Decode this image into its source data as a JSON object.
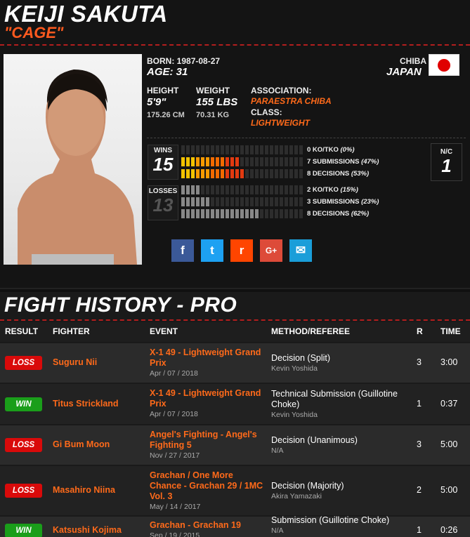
{
  "fighter": {
    "name": "Keiji Sakuta",
    "nickname": "\"Cage\"",
    "born_label": "BORN:",
    "born": "1987-08-27",
    "age_label": "AGE:",
    "age": "31",
    "region": "CHIBA",
    "country": "JAPAN",
    "height_label": "HEIGHT",
    "height_imperial": "5'9\"",
    "height_metric": "175.26 CM",
    "weight_label": "WEIGHT",
    "weight_imperial": "155 LBS",
    "weight_metric": "70.31 KG",
    "association_label": "ASSOCIATION:",
    "association": "Paraestra Chiba",
    "class_label": "CLASS:",
    "class": "Lightweight"
  },
  "record": {
    "wins_label": "WINS",
    "wins": "15",
    "losses_label": "LOSSES",
    "losses": "13",
    "nc_label": "N/C",
    "nc": "1",
    "win_breakdown": [
      {
        "count": 0,
        "text": "0 KO/TKO",
        "pct": "(0%)",
        "fraction": 0.0
      },
      {
        "count": 7,
        "text": "7 SUBMISSIONS",
        "pct": "(47%)",
        "fraction": 0.47
      },
      {
        "count": 8,
        "text": "8 DECISIONS",
        "pct": "(53%)",
        "fraction": 0.53
      }
    ],
    "loss_breakdown": [
      {
        "count": 2,
        "text": "2 KO/TKO",
        "pct": "(15%)",
        "fraction": 0.15
      },
      {
        "count": 3,
        "text": "3 SUBMISSIONS",
        "pct": "(23%)",
        "fraction": 0.23
      },
      {
        "count": 8,
        "text": "8 DECISIONS",
        "pct": "(62%)",
        "fraction": 0.62
      }
    ]
  },
  "social": [
    {
      "name": "facebook",
      "glyph": "f",
      "color": "#3b5998"
    },
    {
      "name": "twitter",
      "glyph": "t",
      "color": "#1da1f2"
    },
    {
      "name": "reddit",
      "glyph": "r",
      "color": "#ff4500"
    },
    {
      "name": "google-plus",
      "glyph": "G+",
      "color": "#dd4b39"
    },
    {
      "name": "email",
      "glyph": "✉",
      "color": "#1a9ed9"
    }
  ],
  "history": {
    "title": "Fight History - Pro",
    "headers": {
      "result": "RESULT",
      "fighter": "FIGHTER",
      "event": "EVENT",
      "method": "METHOD/REFEREE",
      "round": "R",
      "time": "TIME"
    },
    "fights": [
      {
        "result": "LOSS",
        "fighter": "Suguru Nii",
        "event": "X-1 49 - Lightweight Grand Prix",
        "date": "Apr / 07 / 2018",
        "method": "Decision (Split)",
        "referee": "Kevin Yoshida",
        "round": "3",
        "time": "3:00"
      },
      {
        "result": "WIN",
        "fighter": "Titus Strickland",
        "event": "X-1 49 - Lightweight Grand Prix",
        "date": "Apr / 07 / 2018",
        "method": "Technical Submission (Guillotine Choke)",
        "referee": "Kevin Yoshida",
        "round": "1",
        "time": "0:37"
      },
      {
        "result": "LOSS",
        "fighter": "Gi Bum Moon",
        "event": "Angel's Fighting - Angel's Fighting 5",
        "date": "Nov / 27 / 2017",
        "method": "Decision (Unanimous)",
        "referee": "N/A",
        "round": "3",
        "time": "5:00"
      },
      {
        "result": "LOSS",
        "fighter": "Masahiro Niina",
        "event": "Grachan / One More Chance - Grachan 29 / 1MC Vol. 3",
        "date": "May / 14 / 2017",
        "method": "Decision (Majority)",
        "referee": "Akira Yamazaki",
        "round": "2",
        "time": "5:00"
      },
      {
        "result": "WIN",
        "fighter": "Katsushi Kojima",
        "event": "Grachan - Grachan 19",
        "date": "Sep / 19 / 2015",
        "method": "Submission (Guillotine Choke)",
        "referee": "N/A",
        "round": "1",
        "time": "0:26"
      }
    ]
  },
  "colors": {
    "accent": "#ff6a1a",
    "loss": "#d90a0a",
    "win": "#1a9e1a"
  }
}
